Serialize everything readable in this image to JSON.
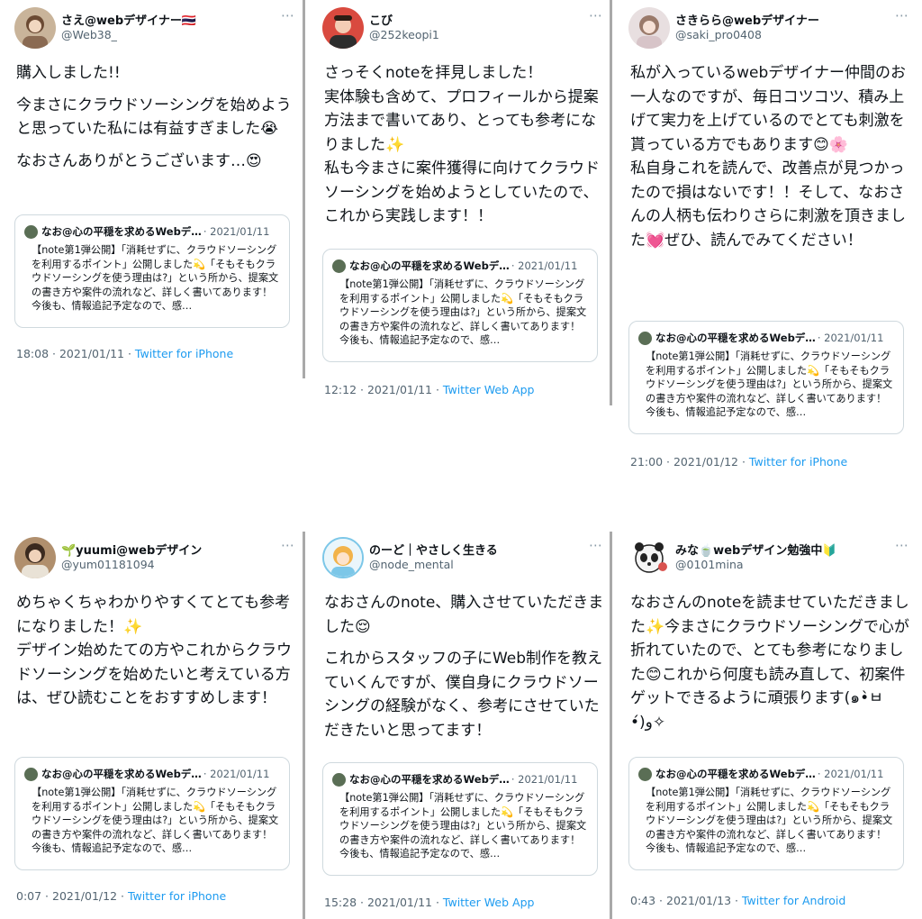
{
  "quoted_tweet": {
    "author": "なお@心の平穏を求めるWebデ…",
    "date": "· 2021/01/11",
    "text": "【note第1弾公開】「消耗せずに、クラウドソーシングを利用するポイント」公開しました💫「そもそもクラウドソーシングを使う理由は?」という所から、提案文の書き方や案件の流れなど、詳しく書いてあります！今後も、情報追記予定なので、感…"
  },
  "tweets": [
    {
      "user": "さえ@webデザイナー🇹🇭",
      "handle": "@Web38_",
      "paragraphs": [
        "購入しました!!",
        "今まさにクラウドソーシングを始めようと思っていた私には有益すぎました😭",
        "なおさんありがとうございます…😍"
      ],
      "time": "18:08 · 2021/01/11 · ",
      "source": "Twitter for iPhone"
    },
    {
      "user": "こび",
      "handle": "@252keopi1",
      "paragraphs": [
        "さっそくnoteを拝見しました！\n実体験も含めて、プロフィールから提案方法まで書いてあり、とっても参考になりました✨\n私も今まさに案件獲得に向けてクラウドソーシングを始めようとしていたので、これから実践します！！"
      ],
      "time": "12:12 · 2021/01/11 · ",
      "source": "Twitter Web App"
    },
    {
      "user": "さきらら@webデザイナー",
      "handle": "@saki_pro0408",
      "paragraphs": [
        "私が入っているwebデザイナー仲間のお一人なのですが、毎日コツコツ、積み上げて実力を上げているのでとても刺激を貰っている方でもあります😊🌸\n私自身これを読んで、改善点が見つかったので損はないです！！そして、なおさんの人柄も伝わりさらに刺激を頂きました💓ぜひ、読んでみてください！"
      ],
      "time": "21:00 · 2021/01/12 · ",
      "source": "Twitter for iPhone"
    },
    {
      "user": "🌱yuumi@webデザイン",
      "handle": "@yum01181094",
      "paragraphs": [
        "めちゃくちゃわかりやすくてとても参考になりました！✨\nデザイン始めたての方やこれからクラウドソーシングを始めたいと考えている方は、ぜひ読むことをおすすめします！"
      ],
      "time": "0:07 · 2021/01/12 · ",
      "source": "Twitter for iPhone"
    },
    {
      "user": "のーど｜やさしく生きる",
      "handle": "@node_mental",
      "paragraphs": [
        "なおさんのnote、購入させていただきました😌",
        "これからスタッフの子にWeb制作を教えていくんですが、僕自身にクラウドソーシングの経験がなく、参考にさせていただきたいと思ってます！"
      ],
      "time": "15:28 · 2021/01/11 · ",
      "source": "Twitter Web App"
    },
    {
      "user": "みな🍵webデザイン勉強中🔰",
      "handle": "@0101mina",
      "paragraphs": [
        "なおさんのnoteを読ませていただきました✨今まさにクラウドソーシングで心が折れていたので、とても参考になりました😊これから何度も読み直して、初案件ゲットできるように頑張ります(๑•̀ㅂ•́)و✧"
      ],
      "time": "0:43 · 2021/01/13 · ",
      "source": "Twitter for Android"
    }
  ],
  "more_icon": "⋯",
  "colors": {
    "link": "#1d9bf0",
    "muted": "#536471",
    "border": "#cfd9de"
  }
}
